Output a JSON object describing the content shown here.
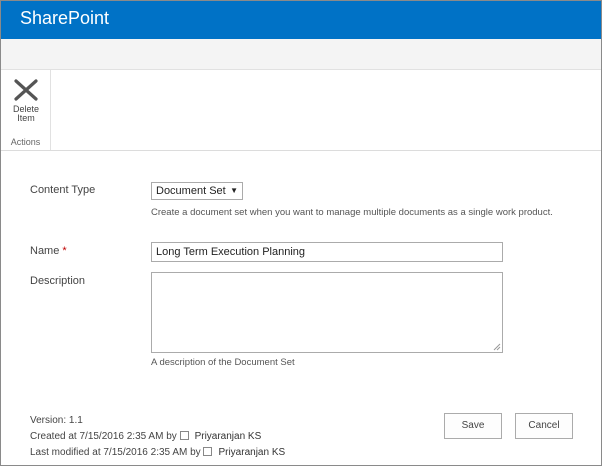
{
  "app": {
    "brand": "SharePoint"
  },
  "ribbon": {
    "delete_item_label": "Delete Item",
    "group_label": "Actions"
  },
  "form": {
    "content_type": {
      "label": "Content Type",
      "selected": "Document Set",
      "help": "Create a document set when you want to manage multiple documents as a single work product."
    },
    "name": {
      "label": "Name",
      "required_marker": "*",
      "value": "Long Term Execution Planning"
    },
    "description": {
      "label": "Description",
      "value": "",
      "help": "A description of the Document Set"
    }
  },
  "footer": {
    "version": "Version: 1.1",
    "created_prefix": "Created at 7/15/2016 2:35 AM  by",
    "created_by": "Priyaranjan KS",
    "modified_prefix": "Last modified at 7/15/2016 2:35 AM  by",
    "modified_by": "Priyaranjan KS",
    "save_label": "Save",
    "cancel_label": "Cancel"
  },
  "colors": {
    "suite_bar": "#0072c6",
    "required": "#bf0000"
  },
  "icons": {
    "delete": "close-x-icon",
    "presence": "presence-indicator-icon"
  }
}
